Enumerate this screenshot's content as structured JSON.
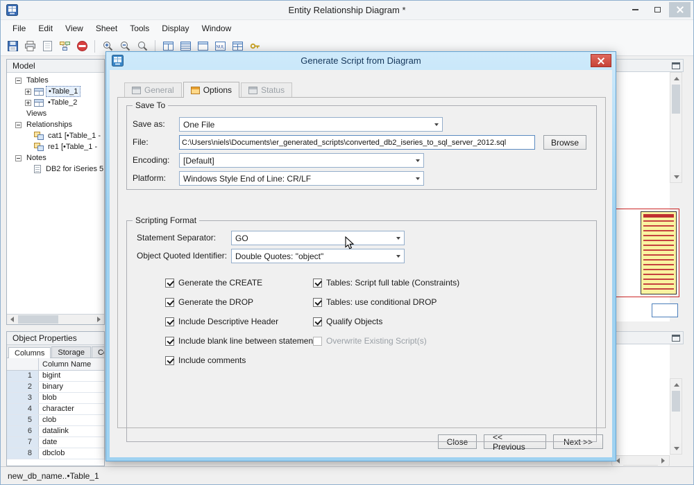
{
  "window": {
    "title": "Entity Relationship Diagram *"
  },
  "menubar": {
    "items": [
      "File",
      "Edit",
      "View",
      "Sheet",
      "Tools",
      "Display",
      "Window"
    ]
  },
  "toolbar": {
    "nul": "NUL"
  },
  "model_panel": {
    "title": "Model",
    "tree": {
      "tables": "Tables",
      "table1": "•Table_1",
      "table2": "•Table_2",
      "views": "Views",
      "relationships": "Relationships",
      "rel1": "cat1 [•Table_1 -",
      "rel2": "re1 [•Table_1 -",
      "notes": "Notes",
      "note1": "DB2 for iSeries 5"
    }
  },
  "object_properties": {
    "title": "Object Properties",
    "tabs": [
      "Columns",
      "Storage",
      "Co"
    ],
    "column_header": "Column Name",
    "rows": [
      {
        "num": "1",
        "name": "bigint"
      },
      {
        "num": "2",
        "name": "binary"
      },
      {
        "num": "3",
        "name": "blob"
      },
      {
        "num": "4",
        "name": "character"
      },
      {
        "num": "5",
        "name": "clob"
      },
      {
        "num": "6",
        "name": "datalink"
      },
      {
        "num": "7",
        "name": "date"
      },
      {
        "num": "8",
        "name": "dbclob"
      }
    ]
  },
  "statusbar": {
    "text": "new_db_name..•Table_1"
  },
  "dialog": {
    "title": "Generate Script from Diagram",
    "tabs": [
      {
        "label": "General"
      },
      {
        "label": "Options"
      },
      {
        "label": "Status"
      }
    ],
    "save_to": {
      "legend": "Save To",
      "save_as_label": "Save as:",
      "save_as_value": "One File",
      "file_label": "File:",
      "file_value": "C:\\Users\\niels\\Documents\\er_generated_scripts\\converted_db2_iseries_to_sql_server_2012.sql",
      "browse": "Browse",
      "encoding_label": "Encoding:",
      "encoding_value": "[Default]",
      "platform_label": "Platform:",
      "platform_value": "Windows Style End of Line: CR/LF"
    },
    "scripting": {
      "legend": "Scripting Format",
      "separator_label": "Statement Separator:",
      "separator_value": "GO",
      "quoted_label": "Object Quoted Identifier:",
      "quoted_value": "Double Quotes: \"object\"",
      "checks_left": [
        "Generate the CREATE",
        "Generate the DROP",
        "Include Descriptive Header",
        "Include blank line between statements",
        "Include comments"
      ],
      "checks_right": [
        "Tables: Script full table (Constraints)",
        "Tables: use conditional DROP",
        "Qualify Objects",
        "Overwrite Existing Script(s)"
      ]
    },
    "buttons": {
      "close": "Close",
      "previous": "<< Previous",
      "next": "Next >>"
    }
  }
}
